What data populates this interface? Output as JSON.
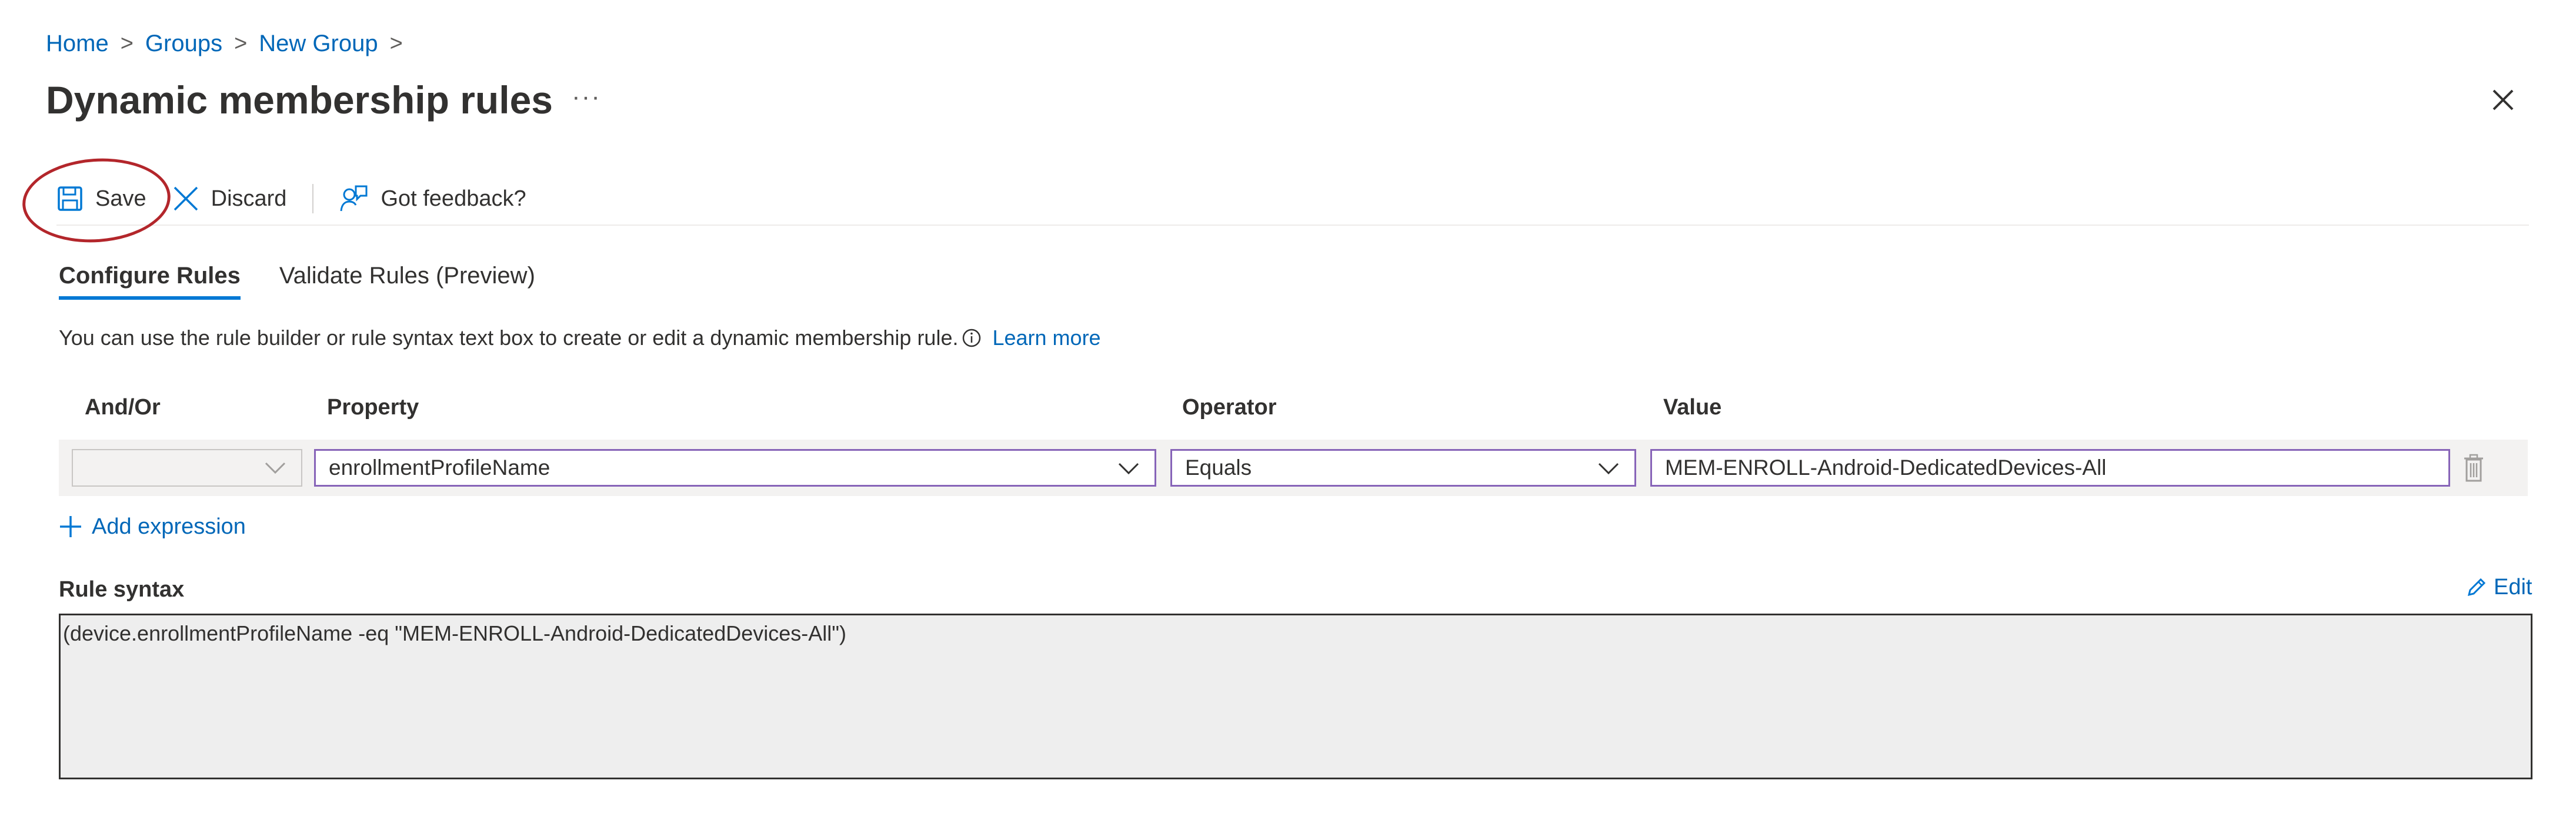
{
  "breadcrumb": {
    "items": [
      "Home",
      "Groups",
      "New Group"
    ],
    "separator": ">"
  },
  "page": {
    "title": "Dynamic membership rules",
    "more_label": "···"
  },
  "toolbar": {
    "save_label": "Save",
    "discard_label": "Discard",
    "feedback_label": "Got feedback?"
  },
  "tabs": [
    {
      "label": "Configure Rules",
      "active": true
    },
    {
      "label": "Validate Rules (Preview)",
      "active": false
    }
  ],
  "description": {
    "text": "You can use the rule builder or rule syntax text box to create or edit a dynamic membership rule.",
    "info_icon": "info-icon",
    "link": "Learn more"
  },
  "table": {
    "headers": [
      "And/Or",
      "Property",
      "Operator",
      "Value"
    ],
    "rows": [
      {
        "and_or": "",
        "property": "enrollmentProfileName",
        "operator": "Equals",
        "value": "MEM-ENROLL-Android-DedicatedDevices-All"
      }
    ]
  },
  "add_expression": "Add expression",
  "rule_syntax": {
    "label": "Rule syntax",
    "edit_label": "Edit",
    "text": "(device.enrollmentProfileName -eq \"MEM-ENROLL-Android-DedicatedDevices-All\")"
  },
  "colors": {
    "accent": "#0078d4",
    "link": "#0067b8",
    "field_border": "#8764b8",
    "annotation_circle": "#b3262b"
  }
}
